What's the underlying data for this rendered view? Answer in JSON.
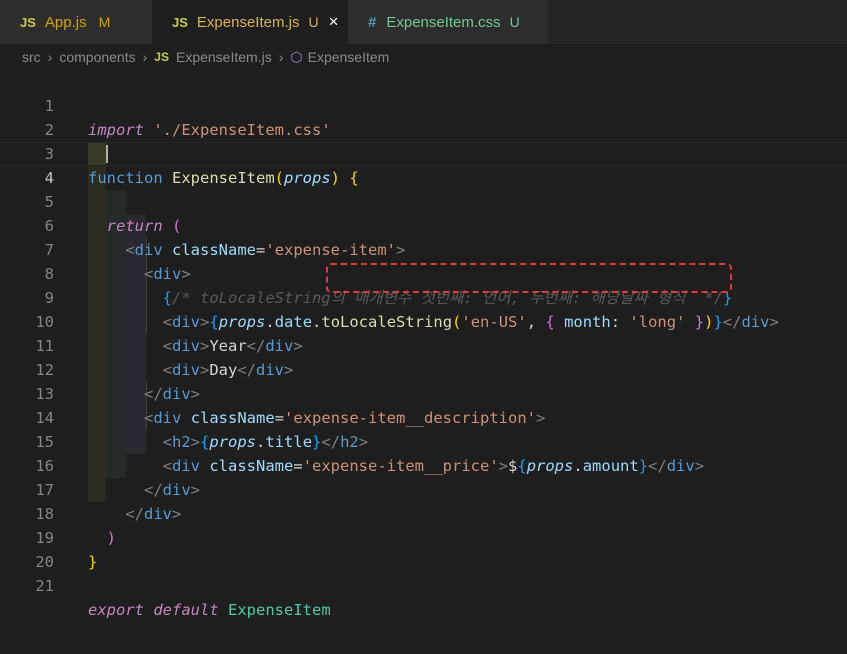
{
  "tabs": [
    {
      "icon": "JS",
      "label": "App.js",
      "badge": "M"
    },
    {
      "icon": "JS",
      "label": "ExpenseItem.js",
      "badge": "U",
      "close": "×"
    },
    {
      "icon": "#",
      "label": "ExpenseItem.css",
      "badge": "U"
    }
  ],
  "breadcrumb": {
    "segments": [
      "src",
      "components",
      "ExpenseItem.js",
      "ExpenseItem"
    ],
    "file_icon": "JS",
    "symbol_icon": "⬡"
  },
  "editor": {
    "line_numbers": [
      "1",
      "2",
      "3",
      "4",
      "5",
      "6",
      "7",
      "8",
      "9",
      "10",
      "11",
      "12",
      "13",
      "14",
      "15",
      "16",
      "17",
      "18",
      "19",
      "20",
      "21"
    ],
    "current_line": 4,
    "tokens": {
      "import": "import",
      "import_path": "'./ExpenseItem.css'",
      "function": "function",
      "component_name": "ExpenseItem",
      "props": "props",
      "return": "return",
      "div": "div",
      "className": "className",
      "class_expense_item": "'expense-item'",
      "comment": "/* toLocaleString의 매개변수 첫번째: 언어, 두번째: 해당날짜 형식  */",
      "date": "date",
      "toLocaleString": "toLocaleString",
      "locale": "'en-US'",
      "month": "month",
      "long": "'long'",
      "year_text": "Year",
      "day_text": "Day",
      "class_description": "'expense-item__description'",
      "h2": "h2",
      "title": "title",
      "class_price": "'expense-item__price'",
      "dollar": "$",
      "amount": "amount",
      "export": "export",
      "default": "default"
    }
  },
  "colors": {
    "background": "#1e1e1e",
    "keyword": "#569cd6",
    "control_keyword": "#c586c0",
    "string": "#ce9178",
    "function": "#dcdcaa",
    "property": "#9cdcfe",
    "comment": "#6a9955",
    "annotation": "#e03c3c"
  }
}
